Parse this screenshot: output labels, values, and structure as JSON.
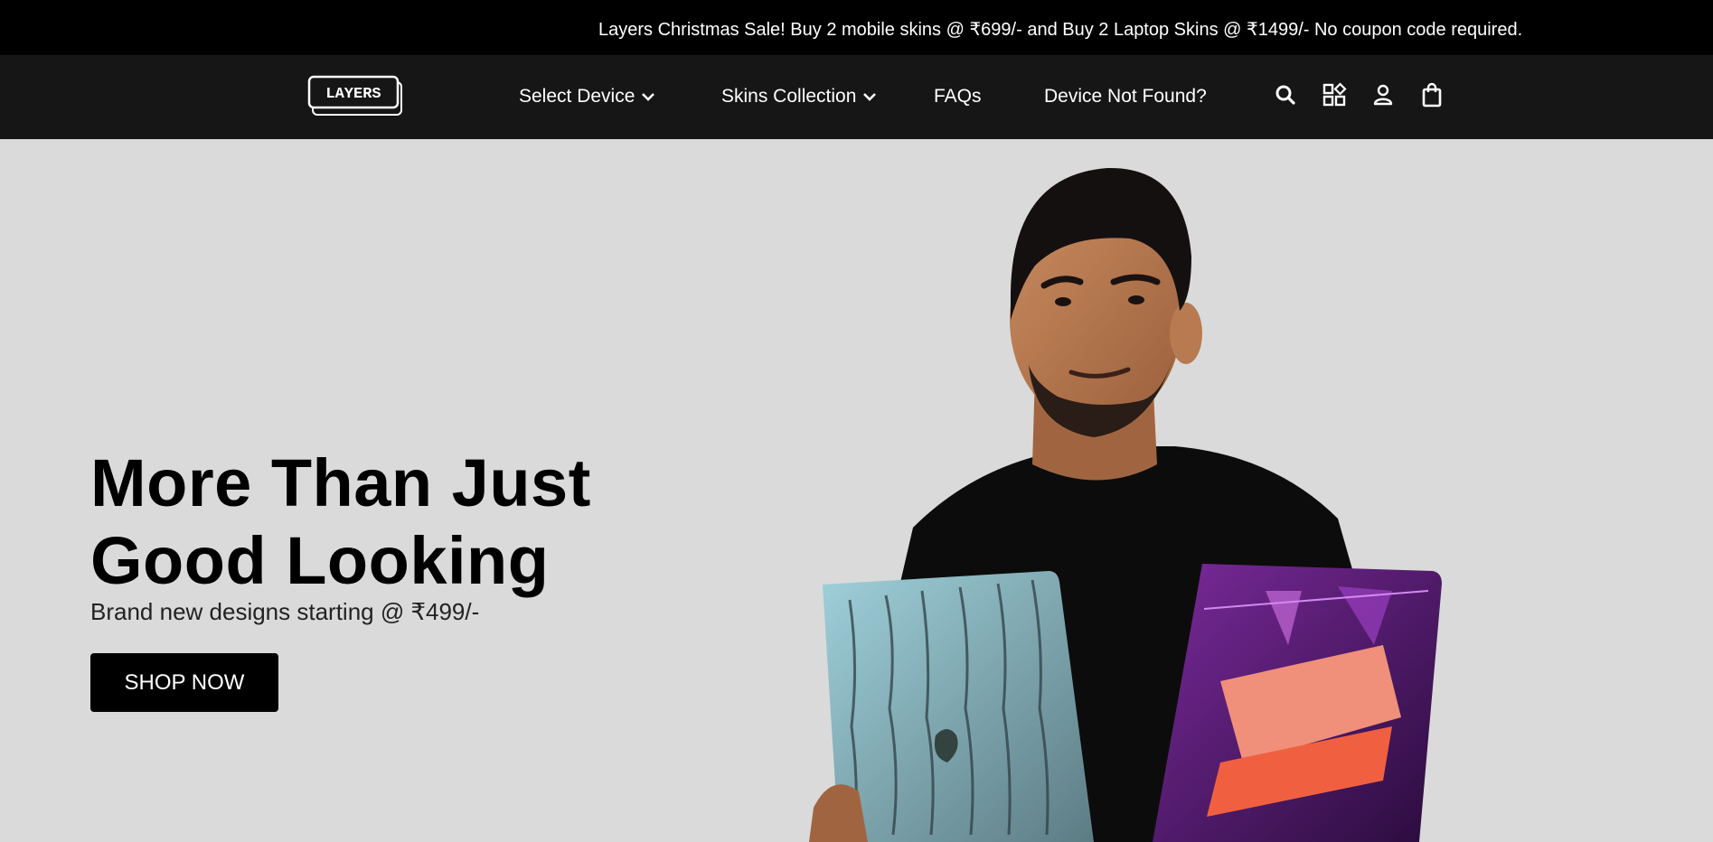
{
  "announcement": "Layers Christmas Sale! Buy 2 mobile skins @ ₹699/- and Buy 2 Laptop Skins @ ₹1499/- No coupon code required.",
  "brand": {
    "logo_text": "LAYERS"
  },
  "nav": {
    "links": [
      {
        "label": "Select Device",
        "dropdown": true
      },
      {
        "label": "Skins Collection",
        "dropdown": true
      },
      {
        "label": "FAQs",
        "dropdown": false
      },
      {
        "label": "Device Not Found?",
        "dropdown": false
      }
    ],
    "icons": [
      "search-icon",
      "apps-grid-icon",
      "user-icon",
      "shopping-bag-icon"
    ]
  },
  "hero": {
    "title_line1": "More Than Just",
    "title_line2": "Good Looking",
    "subtitle": "Brand new designs starting @ ₹499/-",
    "cta_label": "SHOP NOW"
  },
  "colors": {
    "announcement_bg": "#000000",
    "nav_bg": "#161616",
    "hero_bg": "#dadada",
    "cta_bg": "#000000"
  }
}
